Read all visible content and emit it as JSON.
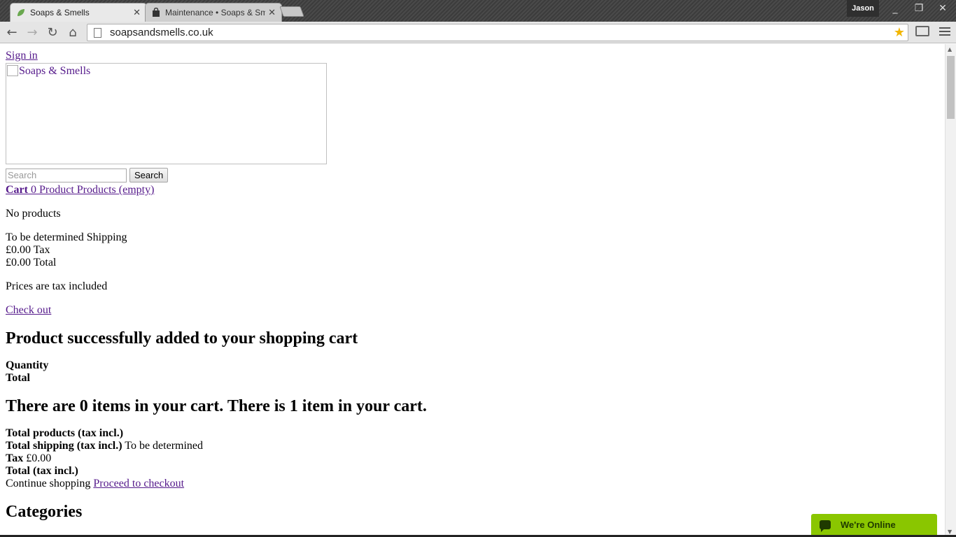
{
  "browser": {
    "tabs": [
      {
        "title": "Soaps & Smells",
        "active": true
      },
      {
        "title": "Maintenance • Soaps & Sm",
        "active": false
      }
    ],
    "profile_name": "Jason",
    "url": "soapsandsmells.co.uk"
  },
  "page": {
    "sign_in": "Sign in",
    "logo_alt": "Soaps & Smells",
    "search": {
      "placeholder": "Search",
      "button": "Search"
    },
    "cart": {
      "label": "Cart",
      "rest": "0 Product Products (empty)"
    },
    "no_products": "No products",
    "summary": {
      "shipping": "To be determined Shipping",
      "tax": "£0.00 Tax",
      "total": "£0.00 Total"
    },
    "prices_note": "Prices are tax included",
    "check_out": "Check out",
    "added_heading": "Product successfully added to your shopping cart",
    "quantity_label": "Quantity",
    "total_label": "Total",
    "items_heading": "There are 0 items in your cart. There is 1 item in your cart.",
    "totals": {
      "products_label": "Total products (tax incl.)",
      "shipping_label": "Total shipping (tax incl.)",
      "shipping_value": "To be determined",
      "tax_label": "Tax",
      "tax_value": "£0.00",
      "total_label": "Total (tax incl.)"
    },
    "continue_shopping": "Continue shopping",
    "proceed_checkout": "Proceed to checkout",
    "categories_heading": "Categories"
  },
  "chat_widget": {
    "label": "We're Online"
  }
}
